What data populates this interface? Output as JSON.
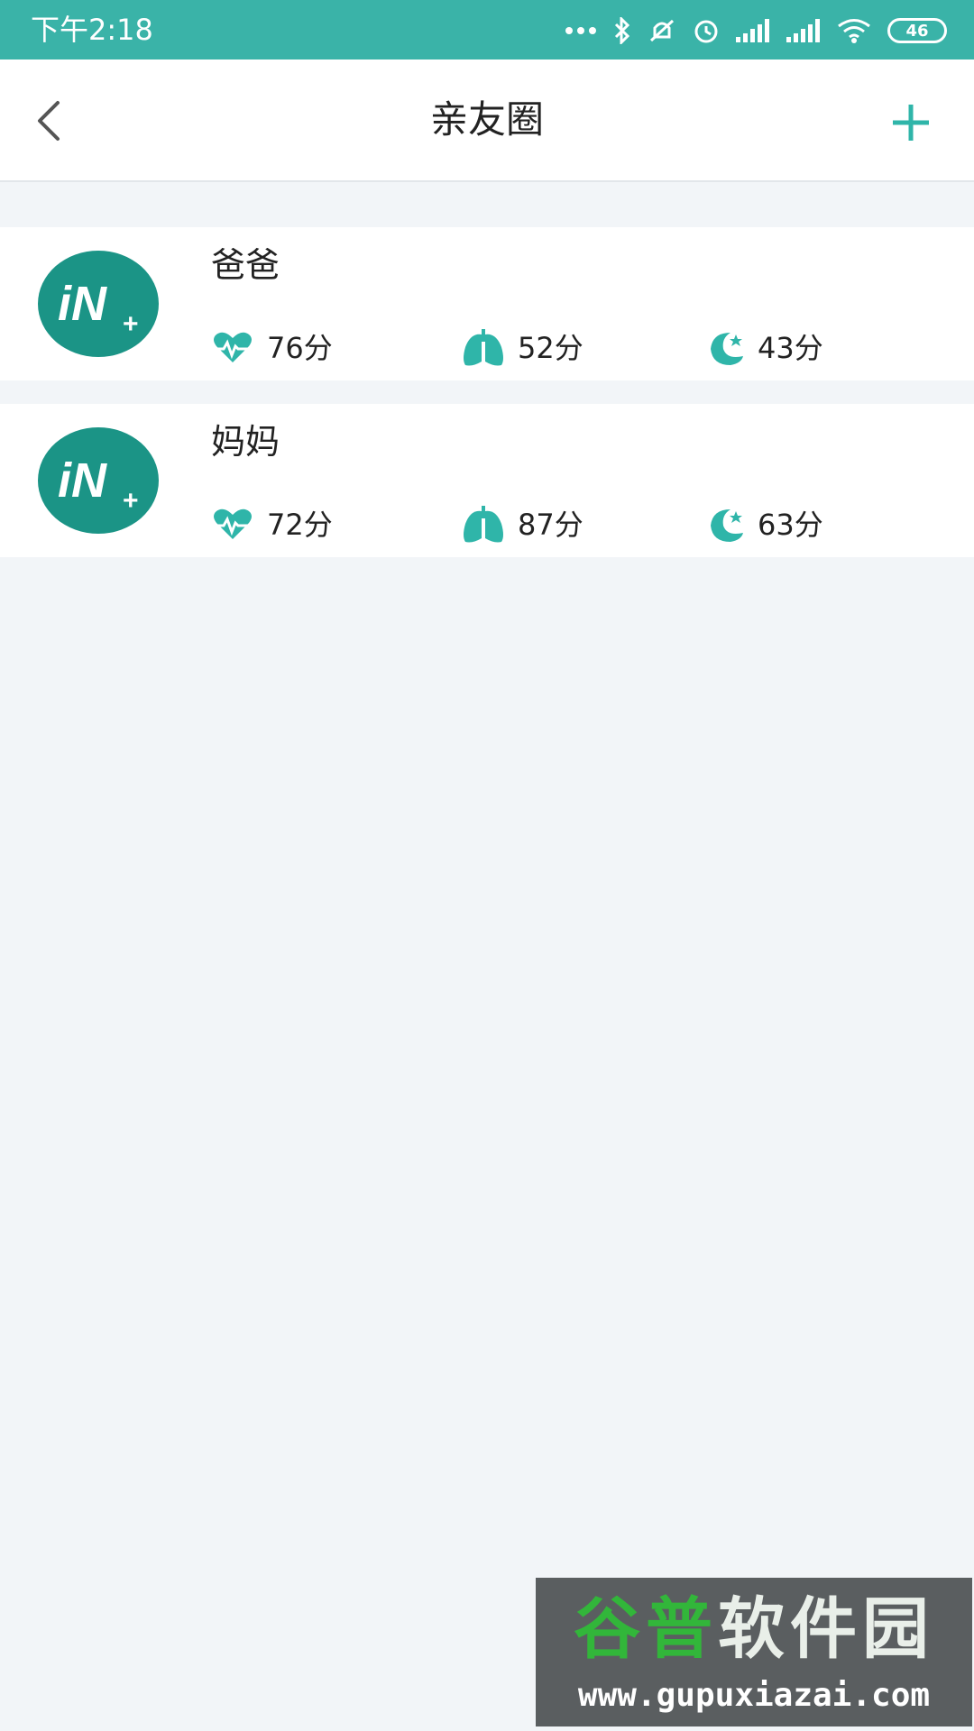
{
  "status_bar": {
    "time": "下午2:18",
    "icons": [
      "more-dots-icon",
      "bluetooth-icon",
      "mute-icon",
      "alarm-icon",
      "signal-icon",
      "signal-icon",
      "wifi-icon",
      "battery-icon"
    ],
    "battery": "46"
  },
  "header": {
    "title": "亲友圈",
    "back_icon": "chevron-left-icon",
    "add_icon": "plus-icon"
  },
  "colors": {
    "status_bar": "#3ab3a8",
    "accent": "#2fb5a9",
    "avatar": "#1b9486",
    "background": "#f2f5f8"
  },
  "members": [
    {
      "name": "爸爸",
      "avatar_text": "iN",
      "avatar_plus": "+",
      "heart_score": "76分",
      "lung_score": "52分",
      "sleep_score": "43分"
    },
    {
      "name": "妈妈",
      "avatar_text": "iN",
      "avatar_plus": "+",
      "heart_score": "72分",
      "lung_score": "87分",
      "sleep_score": "63分"
    }
  ],
  "watermark": {
    "title_part1": "谷普",
    "title_part2": "软件园",
    "url": "www.gupuxiazai.com"
  }
}
